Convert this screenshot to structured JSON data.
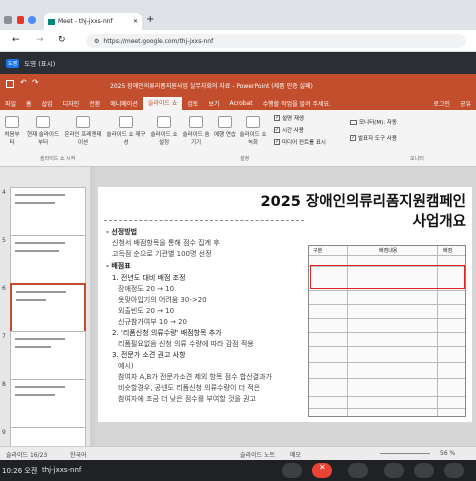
{
  "browser": {
    "tab_title": "Meet - thj-jxxs-nnf",
    "url": "https://meet.google.com/thj-jxxs-nnf"
  },
  "meet": {
    "presenter_label": "도영 (표시)",
    "avatar_text": "도영",
    "time": "10:26 오전",
    "meeting_code": "thj-jxxs-nnf"
  },
  "ppt": {
    "title": "2025 장애인의류리폼지원사업 실무자회의 자료 - PowerPoint (제품 인증 실패)",
    "menu": [
      "파일",
      "홈",
      "삽입",
      "디자인",
      "전환",
      "애니메이션",
      "슬라이드 쇼",
      "검토",
      "보기",
      "Acrobat",
      "수행할 작업을 알려 주세요.",
      "로그인",
      "공유"
    ],
    "ribbon": {
      "buttons": [
        "처음부터",
        "현재 슬라이드부터",
        "온라인 프레젠테이션",
        "슬라이드 쇼 재구성",
        "슬라이드 쇼 설정",
        "슬라이드 숨기기",
        "예행 연습",
        "슬라이드 쇼 녹화"
      ],
      "checks": [
        "설명 재생",
        "시간 사용",
        "미디어 컨트롤 표시"
      ],
      "monitor": "모니터(M): 자동",
      "presenter": "발표자 도구 사용",
      "groups": [
        "슬라이드 쇼 시작",
        "설정",
        "모니터"
      ]
    },
    "thumb_numbers": [
      "4",
      "5",
      "6",
      "7",
      "8",
      "9"
    ],
    "slide": {
      "title_line1": "2025 장애인의류리폼지원캠페인",
      "title_line2": "사업개요",
      "lines": [
        "- 선정방법",
        "신청서 배점항목을 통해 점수 집계 후",
        "고득점 순으로 기관별 100명 선정",
        "- 배점표",
        "1. 전년도 대비 배점 조정",
        "장애정도 20 → 10",
        "옷맞아입기의 어려움 30->20",
        "외출빈도 20 → 10",
        "신규참가여부 10 → 20",
        "2. '리폼신청 의류수량' 배점항목 추가",
        "리폼필요없음 신청 의류 수량에 따라 감점 적용",
        "3. 전문가 소견 권고 사항",
        "예시)",
        "참여자 A,B가 전문가소견 제외 항목 점수 합산결과가",
        "비슷할경우, 공넨도 리폼신청 의류수량이 더 적은",
        "참여자에 조금 더 낮은 점수를 부여할 것을 권고"
      ],
      "table_headers": [
        "구분",
        "배점내용",
        "배점"
      ]
    },
    "status": {
      "slide_info": "슬라이드 16/23",
      "language": "한국어",
      "notes": "슬라이드 노트",
      "comments": "메모",
      "zoom": "56 %"
    }
  }
}
